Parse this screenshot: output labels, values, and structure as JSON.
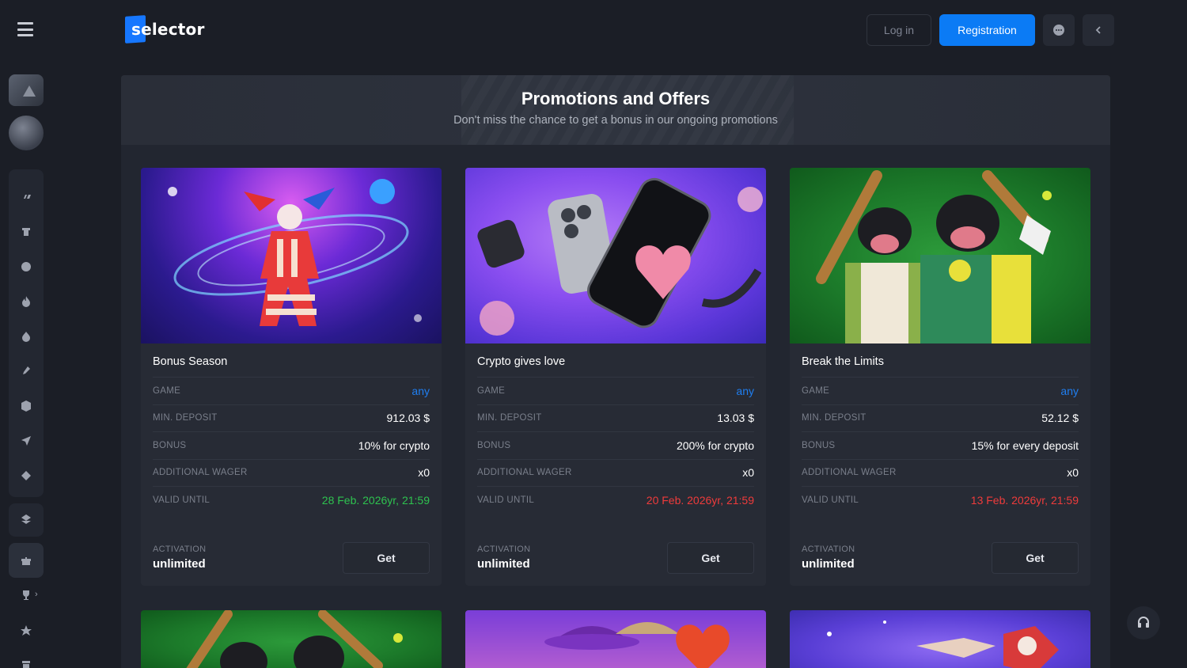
{
  "header": {
    "logo_text": "selector",
    "login_label": "Log in",
    "register_label": "Registration"
  },
  "sidebar": {
    "icons": [
      "basketball-icon",
      "soccer-icon",
      "tennis-icon",
      "fire-icon",
      "flame-icon",
      "hockey-icon",
      "dice-icon",
      "rocket-icon",
      "ticket-icon",
      "layers-icon",
      "gift-icon",
      "trophy-icon",
      "star-icon"
    ]
  },
  "banner": {
    "title": "Promotions and Offers",
    "subtitle": "Don't miss the chance to get a bonus in our ongoing promotions"
  },
  "labels": {
    "game": "GAME",
    "min_deposit": "MIN. DEPOSIT",
    "bonus": "BONUS",
    "additional_wager": "ADDITIONAL WAGER",
    "valid_until": "VALID UNTIL",
    "activation": "ACTIVATION",
    "get": "Get"
  },
  "promotions": [
    {
      "title": "Bonus Season",
      "game": "any",
      "min_deposit": "912.03 $",
      "bonus": "10% for crypto",
      "additional_wager": "x0",
      "valid_until": "28 Feb. 2026yr, 21:59",
      "valid_status": "green",
      "activation": "unlimited"
    },
    {
      "title": "Crypto gives love",
      "game": "any",
      "min_deposit": "13.03 $",
      "bonus": "200% for crypto",
      "additional_wager": "x0",
      "valid_until": "20 Feb. 2026yr, 21:59",
      "valid_status": "red",
      "activation": "unlimited"
    },
    {
      "title": "Break the Limits",
      "game": "any",
      "min_deposit": "52.12 $",
      "bonus": "15% for every deposit",
      "additional_wager": "x0",
      "valid_until": "13 Feb. 2026yr, 21:59",
      "valid_status": "red",
      "activation": "unlimited"
    }
  ],
  "colors": {
    "accent": "#0b7bf5",
    "link": "#1f7ef0",
    "valid_green": "#2ec24f",
    "valid_red": "#ef3b3b",
    "bg": "#1b1e26",
    "card": "#272b35"
  }
}
